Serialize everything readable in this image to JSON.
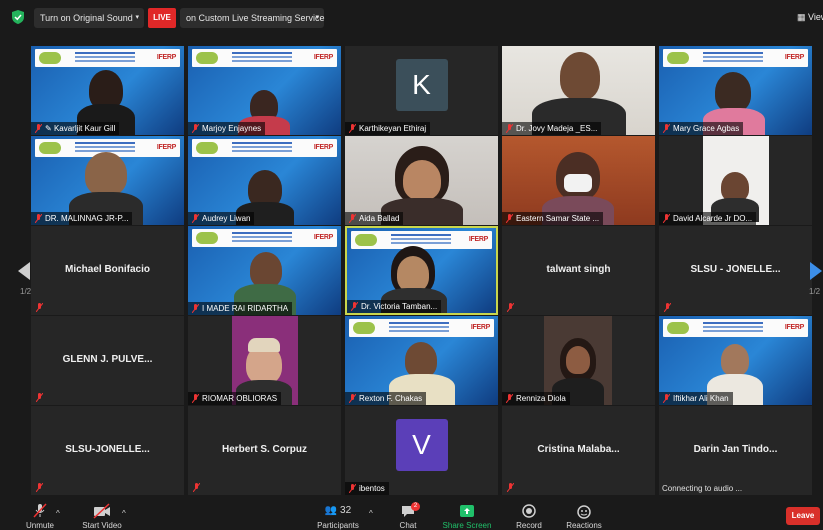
{
  "topbar": {
    "original_sound": "Turn on Original Sound",
    "live_badge": "LIVE",
    "live_stream": "on Custom Live Streaming Service",
    "view": "View"
  },
  "participants": {
    "p1": "Kavarljit Kaur Gill",
    "p2": "Marjoy Enjaynes",
    "p3": "Karthikeyan Ethiraj",
    "p3_initial": "K",
    "p4": "Dr. Jovy Madeja _ES...",
    "p5": "Mary Grace Agbas",
    "p6": "DR. MALINNAG JR-P...",
    "p7": "Audrey Liwan",
    "p8": "Aida Ballad",
    "p9": "Eastern Samar State ...",
    "p10": "David Alcarde Jr DO...",
    "p11": "Michael Bonifacio",
    "p12": "I MADE RAI RIDARTHA",
    "p13": "Dr. Victoria Tamban...",
    "p14": "talwant singh",
    "p15": "SLSU - JONELLE...",
    "p16": "GLENN J. PULVE...",
    "p17": "RIOMAR OBLIORAS",
    "p18": "Rexton F. Chakas",
    "p19": "Renniza Diola",
    "p20": "Iftikhar Ali Khan",
    "p21": "SLSU-JONELLE...",
    "p22": "Herbert S. Corpuz",
    "p23": "ibentos",
    "p23_initial": "V",
    "p24": "Cristina  Malaba...",
    "p25": "Darin Jan Tindo...",
    "p25_status": "Connecting to audio ..."
  },
  "pagination": {
    "left": "1/2",
    "right": "1/2"
  },
  "banner_logo": "IFERP",
  "toolbar": {
    "unmute": "Unmute",
    "start_video": "Start Video",
    "participants": "Participants",
    "participants_count": "32",
    "chat": "Chat",
    "chat_badge": "2",
    "share_screen": "Share Screen",
    "record": "Record",
    "reactions": "Reactions",
    "leave": "Leave"
  },
  "colors": {
    "live": "#e02828",
    "active_speaker": "#c9d64c",
    "share_screen": "#20c06a",
    "leave": "#d9302a",
    "k_tile": "#3b4f5a",
    "v_tile": "#5b3fb8"
  }
}
